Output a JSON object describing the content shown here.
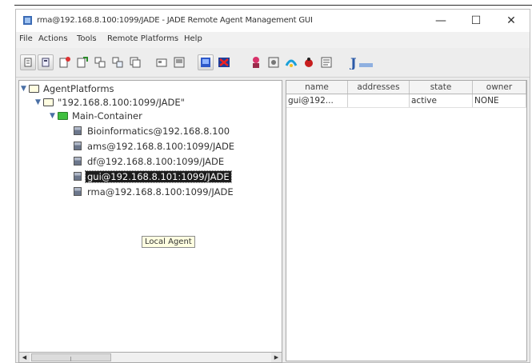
{
  "window": {
    "title": "rma@192.168.8.100:1099/JADE - JADE Remote Agent Management GUI",
    "controls": {
      "minimize": "—",
      "maximize": "☐",
      "close": "✕"
    }
  },
  "menubar": {
    "items": [
      "File",
      "Actions",
      "Tools",
      "Remote Platforms",
      "Help"
    ]
  },
  "toolbar": {
    "buttons": [
      "new-agent-icon",
      "open-icon",
      "start-agent-icon",
      "kill-agent-icon",
      "suspend-icon",
      "resume-icon",
      "clone-icon",
      "migrate-icon",
      "save-icon",
      "platform-icon",
      "kill-container-icon",
      "sniffer-icon",
      "dummy-agent-icon",
      "introspector-icon",
      "debug-icon",
      "log-manager-icon",
      "jade-logo-icon"
    ]
  },
  "tree": {
    "root": "AgentPlatforms",
    "platform": "\"192.168.8.100:1099/JADE\"",
    "container": "Main-Container",
    "agents": [
      "Bioinformatics@192.168.8.100",
      "ams@192.168.8.100:1099/JADE",
      "df@192.168.8.100:1099/JADE",
      "gui@192.168.8.101:1099/JADE",
      "rma@192.168.8.100:1099/JADE"
    ],
    "selected_index": 3,
    "tooltip": "Local Agent"
  },
  "table": {
    "columns": [
      "name",
      "addresses",
      "state",
      "owner"
    ],
    "rows": [
      [
        "gui@192...",
        "",
        "active",
        "NONE"
      ]
    ]
  }
}
